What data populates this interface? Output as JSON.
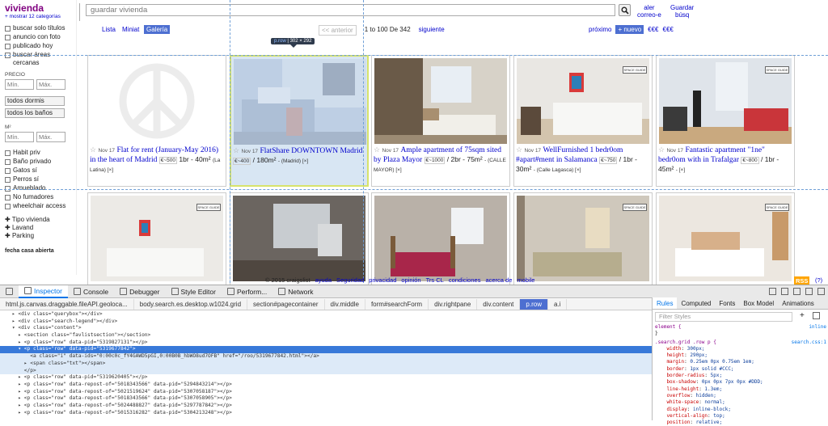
{
  "sidebar": {
    "site_title": "vivienda",
    "show_categories": "+ mostrar 12 categorías",
    "checks": [
      "buscar solo títulos",
      "anuncio con foto",
      "publicado hoy",
      "buscar áreas cercanas"
    ],
    "price_label": "PRECIO",
    "min_placeholder": "Mín.",
    "max_placeholder": "Máx.",
    "dorms": "todos dormis",
    "baths": "todos los baños",
    "ft_label": "M²",
    "ft_min_placeholder": "Mín.",
    "ft_max_placeholder": "Máx.",
    "amenities": [
      "Habit priv",
      "Baño privado",
      "Gatos sí",
      "Perros sí",
      "Amueblado",
      "No fumadores",
      "wheelchair access"
    ],
    "expanders": [
      "Tipo vivienda",
      "Lavand",
      "Parking"
    ],
    "cut_label": "fecha casa abierta"
  },
  "topbar": {
    "search_placeholder": "guardar vivienda",
    "alert_line1": "aler",
    "alert_line2": "correo-e",
    "save_line1": "Guardar",
    "save_line2": "búsq"
  },
  "viewrow": {
    "tabs": [
      "Lista",
      "Miniat",
      "Galería"
    ],
    "prev": "<< anterior",
    "range": "1 to 100 De 342",
    "next": "siguiente",
    "next_right": "próximo",
    "new_btn": "+ nuevo",
    "cur1": "€€€",
    "cur2": "€€€"
  },
  "tooltip": {
    "tag": "p.row",
    "size": "302 × 292"
  },
  "listings": [
    {
      "date": "Nov 17",
      "title": "Flat for rent (January-May 2016) in the heart of Madrid",
      "price": "€~500",
      "meta": "1br - 40m²",
      "loc": "(La Latina) [×]"
    },
    {
      "date": "Nov 17",
      "title": "FlatShare DOWNTOWN Madrid",
      "price": "€~400",
      "meta": "/ 180m²",
      "loc": "- (Madrid) [×]"
    },
    {
      "date": "Nov 17",
      "title": "Ample apartment of 75sqm sited by Plaza Mayor",
      "price": "€~1000",
      "meta": "/ 2br - 75m²",
      "loc": "- (CALLE MAYOR) [×]"
    },
    {
      "date": "Nov 17",
      "title": "WellFurnished 1 bedr0om #apart#ment in Salamanca",
      "price": "€~750",
      "meta": "/ 1br - 30m²",
      "loc": "- (Calle Lagasca) [×]"
    },
    {
      "date": "Nov 17",
      "title": "Fantastic apartment \"1ne\" bedr0om with in Trafalgar",
      "price": "€~800",
      "meta": "/ 1br - 45m²",
      "loc": "- [×]"
    }
  ],
  "watermark": "SPACE GUIDE",
  "footer": {
    "copyright": "© 2015 craigslist",
    "links": [
      "ayuda",
      "Seguridad",
      "privacidad",
      "opinión",
      "Trs CL",
      "condiciones",
      "acerca de",
      "mobile"
    ],
    "rss": "RSS",
    "help": "(?)"
  },
  "devtools": {
    "tabs": [
      "Inspector",
      "Console",
      "Debugger",
      "Style Editor",
      "Perform...",
      "Network"
    ],
    "breadcrumbs": [
      "html.js.canvas.draggable.fileAPI.geoloca...",
      "body.search.es.desktop.w1024.grid",
      "section#pagecontainer",
      "div.middle",
      "form#searchForm",
      "div.rightpane",
      "div.content",
      "p.row",
      "a.i"
    ],
    "markup_lines": [
      "    ▸ <div class=\"querybox\"></div>",
      "    ▸ <div class=\"search-legend\"></div>",
      "    ▾ <div class=\"content\">",
      "      ▸ <section class=\"favlistsection\"></section>",
      "      ▸ <p class=\"row\" data-pid=\"5319827131\"></p>",
      "      ▾ <p class=\"row\" data-pid=\"5319677842\">",
      "          <a class=\"i\" data-ids=\"0:00c0c_fY4GAWD5pGI,0:00B0B_hbWO8ud7OFB\" href=\"/roo/5319677842.html\"></a>",
      "        ▸ <span class=\"txt\"></span>",
      "        </p>",
      "      ▸ <p class=\"row\" data-pid=\"5319620405\"></p>",
      "      ▸ <p class=\"row\" data-repost-of=\"5018343566\" data-pid=\"5294843214\"></p>",
      "      ▸ <p class=\"row\" data-repost-of=\"5021519624\" data-pid=\"5307058187\"></p>",
      "      ▸ <p class=\"row\" data-repost-of=\"5018343566\" data-pid=\"5307058905\"></p>",
      "      ▸ <p class=\"row\" data-repost-of=\"5024488827\" data-pid=\"5297787842\"></p>",
      "      ▸ <p class=\"row\" data-repost-of=\"5015316282\" data-pid=\"5304213248\"></p>"
    ],
    "rules_tabs": [
      "Rules",
      "Computed",
      "Fonts",
      "Box Model",
      "Animations"
    ],
    "filter_placeholder": "Filter Styles",
    "element_rule": "element {",
    "element_close": "}",
    "inline_label": "inline",
    "selector": ".search.grid .row p {",
    "source": "search.css:1",
    "declarations": [
      {
        "p": "width",
        "v": "300px;"
      },
      {
        "p": "height",
        "v": "290px;"
      },
      {
        "p": "margin",
        "v": "0.25em 0px 0.75em 1em;"
      },
      {
        "p": "border",
        "v": "1px solid #CCC;"
      },
      {
        "p": "border-radius",
        "v": "5px;"
      },
      {
        "p": "box-shadow",
        "v": "0px 0px 7px 0px #DDD;"
      },
      {
        "p": "line-height",
        "v": "1.3em;"
      },
      {
        "p": "overflow",
        "v": "hidden;"
      },
      {
        "p": "white-space",
        "v": "normal;"
      },
      {
        "p": "display",
        "v": "inline-block;"
      },
      {
        "p": "vertical-align",
        "v": "top;"
      },
      {
        "p": "position",
        "v": "relative;"
      }
    ]
  },
  "colors": {
    "accent": "#4d6fd1",
    "link": "#0000cc",
    "brand": "#800080",
    "highlight": "#d8e6f3",
    "rss": "#ffa500"
  }
}
